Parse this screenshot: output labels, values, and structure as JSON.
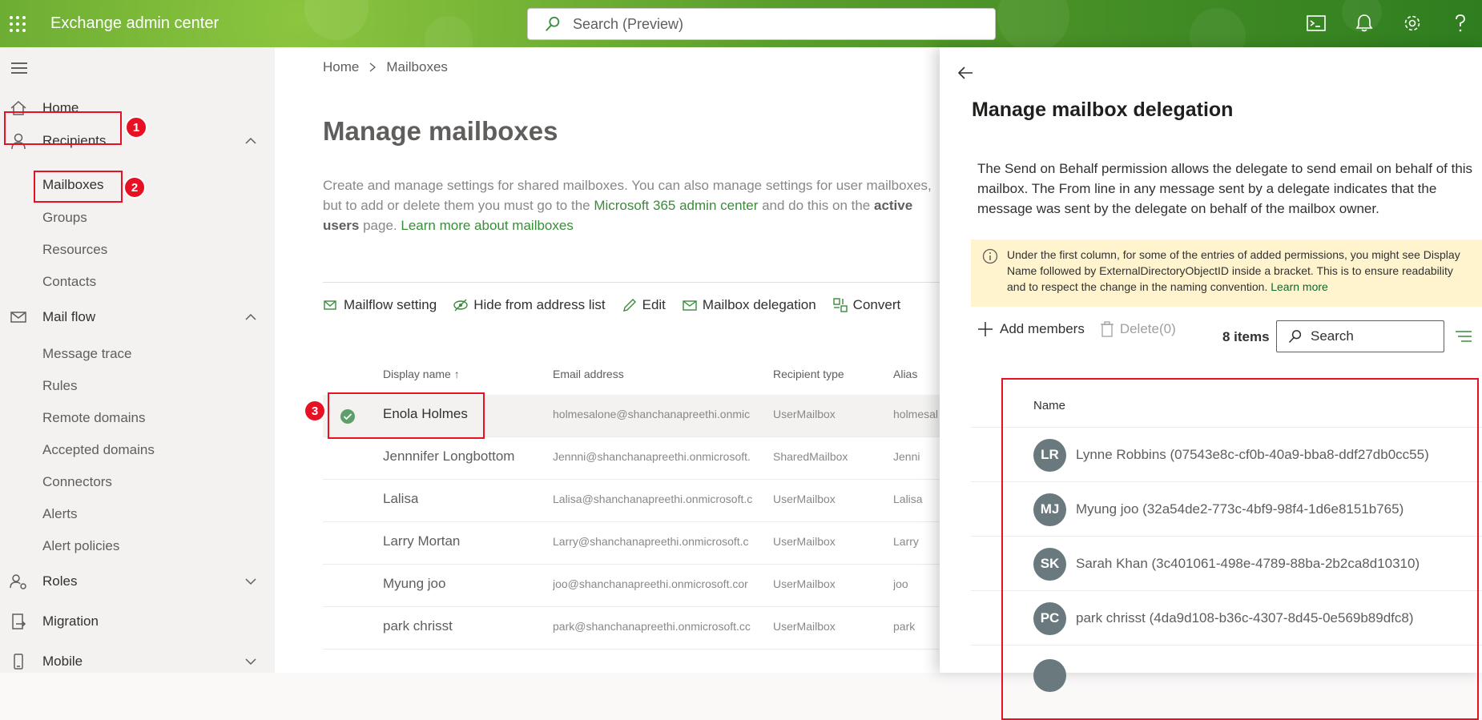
{
  "header": {
    "app_title": "Exchange admin center",
    "search_placeholder": "Search (Preview)"
  },
  "sidebar": {
    "items": [
      {
        "label": "Home"
      },
      {
        "label": "Recipients"
      },
      {
        "label": "Mailflow"
      },
      {
        "label": "Roles"
      },
      {
        "label": "Migration"
      },
      {
        "label": "Mobile"
      }
    ],
    "recipients_sub": [
      "Mailboxes",
      "Groups",
      "Resources",
      "Contacts"
    ],
    "mailflow_sub": [
      "Message trace",
      "Rules",
      "Remote domains",
      "Accepted domains",
      "Connectors",
      "Alerts",
      "Alert policies"
    ],
    "mailflow_label": "Mail flow"
  },
  "annotations": [
    "1",
    "2",
    "3"
  ],
  "main": {
    "breadcrumb": {
      "home": "Home",
      "current": "Mailboxes"
    },
    "title": "Manage mailboxes",
    "description": {
      "part1": "Create and manage settings for shared mailboxes. You can also manage settings for user mailboxes, but to add or delete them you must go to the ",
      "link1": "Microsoft 365 admin center",
      "part2": " and do this on the ",
      "bold": "active users",
      "part3": " page. ",
      "link2": "Learn more about mailboxes"
    },
    "commands": [
      "Mailflow setting",
      "Hide from address list",
      "Edit",
      "Mailbox delegation",
      "Convert"
    ],
    "columns": [
      "Display name ↑",
      "Email address",
      "Recipient type",
      "Alias"
    ],
    "rows": [
      {
        "name": "Enola Holmes",
        "email": "holmesalone@shanchanapreethi.onmic",
        "type": "UserMailbox",
        "alias": "holmesal"
      },
      {
        "name": "Jennnifer Longbottom",
        "email": "Jennni@shanchanapreethi.onmicrosoft.",
        "type": "SharedMailbox",
        "alias": "Jenni"
      },
      {
        "name": "Lalisa",
        "email": "Lalisa@shanchanapreethi.onmicrosoft.c",
        "type": "UserMailbox",
        "alias": "Lalisa"
      },
      {
        "name": "Larry Mortan",
        "email": "Larry@shanchanapreethi.onmicrosoft.c",
        "type": "UserMailbox",
        "alias": "Larry"
      },
      {
        "name": "Myung joo",
        "email": "joo@shanchanapreethi.onmicrosoft.cor",
        "type": "UserMailbox",
        "alias": "joo"
      },
      {
        "name": "park chrisst",
        "email": "park@shanchanapreethi.onmicrosoft.cc",
        "type": "UserMailbox",
        "alias": "park"
      }
    ]
  },
  "panel": {
    "title": "Manage mailbox delegation",
    "description": "The Send on Behalf permission allows the delegate to send email on behalf of this mailbox. The From line in any message sent by a delegate indicates that the message was sent by the delegate on behalf of the mailbox owner.",
    "info_text": "Under the first column, for some of the entries of added permissions, you might see Display Name followed by ExternalDirectoryObjectID inside a bracket. This is to ensure readability and to respect the change in the naming convention. ",
    "info_link": "Learn more",
    "add_label": "Add members",
    "delete_label": "Delete(0)",
    "count": "8 items",
    "search_placeholder": "Search",
    "column_name": "Name",
    "members": [
      {
        "initials": "LR",
        "name": "Lynne Robbins (07543e8c-cf0b-40a9-bba8-ddf27db0cc55)"
      },
      {
        "initials": "MJ",
        "name": "Myung joo (32a54de2-773c-4bf9-98f4-1d6e8151b765)"
      },
      {
        "initials": "SK",
        "name": "Sarah Khan (3c401061-498e-4789-88ba-2b2ca8d10310)"
      },
      {
        "initials": "PC",
        "name": "park chrisst (4da9d108-b36c-4307-8d45-0e569b89dfc8)"
      }
    ]
  },
  "colors": {
    "accent_green": "#3a8c3a",
    "annotation_red": "#e81123",
    "avatar_gray": "#69797e"
  }
}
